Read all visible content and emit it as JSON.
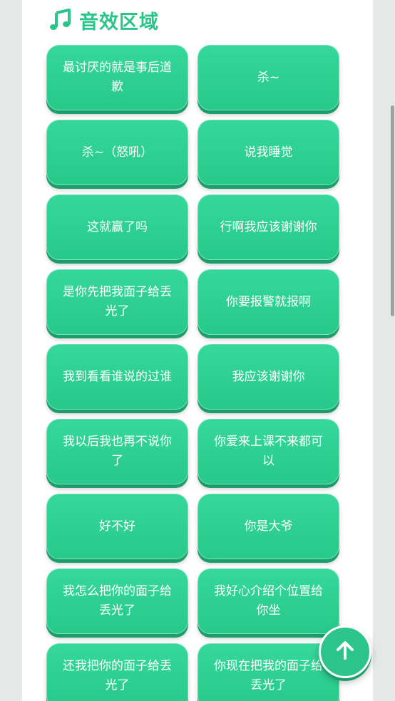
{
  "section": {
    "title": "音效区域",
    "icon": "music-note-icon",
    "accent_color": "#2bc58c"
  },
  "sound_buttons": [
    {
      "label": "最讨厌的就是事后道歉"
    },
    {
      "label": "杀~"
    },
    {
      "label": "杀~（怒吼）"
    },
    {
      "label": "说我睡觉"
    },
    {
      "label": "这就赢了吗"
    },
    {
      "label": "行啊我应该谢谢你"
    },
    {
      "label": "是你先把我面子给丢光了"
    },
    {
      "label": "你要报警就报啊"
    },
    {
      "label": "我到看看谁说的过谁"
    },
    {
      "label": "我应该谢谢你"
    },
    {
      "label": "我以后我也再不说你了"
    },
    {
      "label": "你爱来上课不来都可以"
    },
    {
      "label": "好不好"
    },
    {
      "label": "你是大爷"
    },
    {
      "label": "我怎么把你的面子给丢光了"
    },
    {
      "label": "我好心介绍个位置给你坐"
    },
    {
      "label": "还我把你的面子给丢光了"
    },
    {
      "label": "你现在把我的面子给丢光了"
    }
  ],
  "back_to_top": {
    "icon": "arrow-up-icon"
  }
}
